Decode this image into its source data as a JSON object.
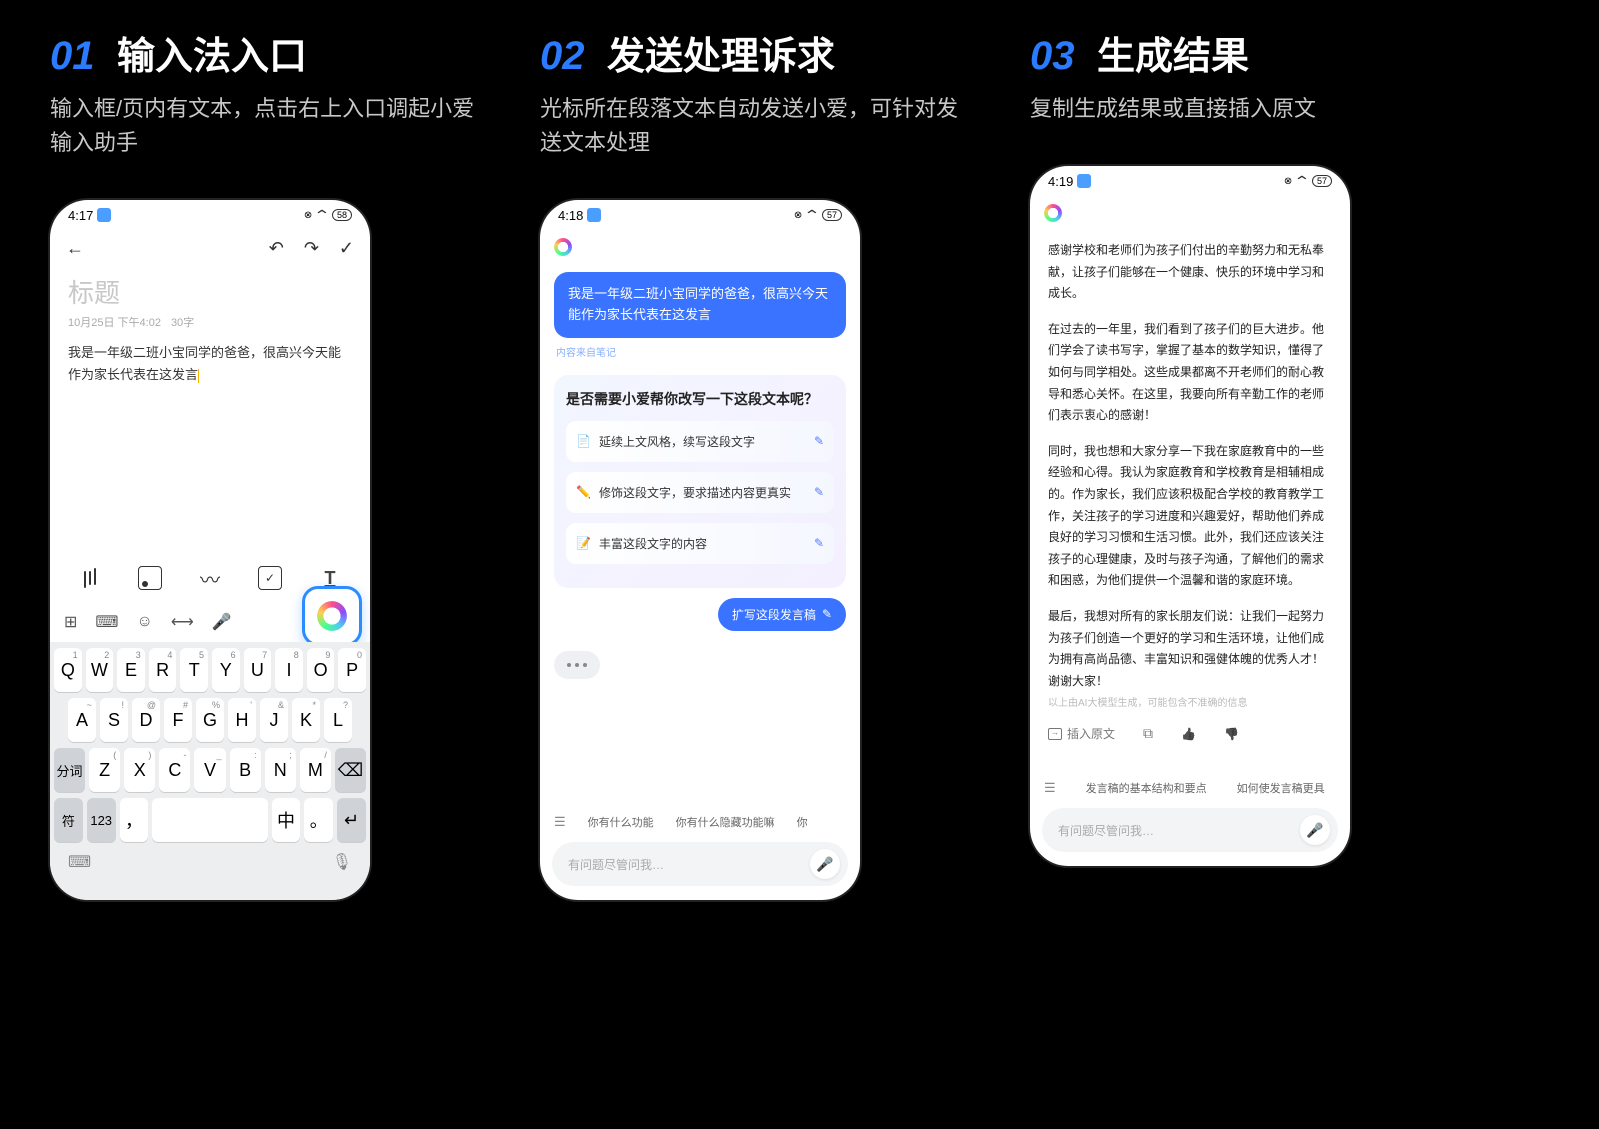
{
  "steps": [
    {
      "num": "01",
      "title": "输入法入口",
      "desc": "输入框/页内有文本，点击右上入口调起小爱输入助手"
    },
    {
      "num": "02",
      "title": "发送处理诉求",
      "desc": "光标所在段落文本自动发送小爱，可针对发送文本处理"
    },
    {
      "num": "03",
      "title": "生成结果",
      "desc": "复制生成结果或直接插入原文"
    }
  ],
  "phone1": {
    "time": "4:17",
    "battery": "58",
    "title_placeholder": "标题",
    "date": "10月25日 下午4:02",
    "wordcount": "30字",
    "body": "我是一年级二班小宝同学的爸爸，很高兴今天能作为家长代表在这发言",
    "keyboard": {
      "row1": [
        {
          "k": "Q",
          "s": "1"
        },
        {
          "k": "W",
          "s": "2"
        },
        {
          "k": "E",
          "s": "3"
        },
        {
          "k": "R",
          "s": "4"
        },
        {
          "k": "T",
          "s": "5"
        },
        {
          "k": "Y",
          "s": "6"
        },
        {
          "k": "U",
          "s": "7"
        },
        {
          "k": "I",
          "s": "8"
        },
        {
          "k": "O",
          "s": "9"
        },
        {
          "k": "P",
          "s": "0"
        }
      ],
      "row2": [
        {
          "k": "A",
          "s": "~"
        },
        {
          "k": "S",
          "s": "!"
        },
        {
          "k": "D",
          "s": "@"
        },
        {
          "k": "F",
          "s": "#"
        },
        {
          "k": "G",
          "s": "%"
        },
        {
          "k": "H",
          "s": "'"
        },
        {
          "k": "J",
          "s": "&"
        },
        {
          "k": "K",
          "s": "*"
        },
        {
          "k": "L",
          "s": "?"
        }
      ],
      "row3_seg": "分词",
      "row3": [
        {
          "k": "Z",
          "s": "("
        },
        {
          "k": "X",
          "s": ")"
        },
        {
          "k": "C",
          "s": "-"
        },
        {
          "k": "V",
          "s": "_"
        },
        {
          "k": "B",
          "s": ":"
        },
        {
          "k": "N",
          "s": ";"
        },
        {
          "k": "M",
          "s": "/"
        }
      ],
      "row4": {
        "sym": "符",
        "num": "123",
        "comma": "，",
        "space": "",
        "zhong": "中",
        "period": "。"
      }
    }
  },
  "phone2": {
    "time": "4:18",
    "battery": "57",
    "user_msg": "我是一年级二班小宝同学的爸爸，很高兴今天能作为家长代表在这发言",
    "source_note": "内容来自笔记",
    "card_title": "是否需要小爱帮你改写一下这段文本呢？",
    "options": [
      {
        "icon": "📄",
        "text": "延续上文风格，续写这段文字"
      },
      {
        "icon": "✏️",
        "text": "修饰这段文字，要求描述内容更真实"
      },
      {
        "icon": "📝",
        "text": "丰富这段文字的内容"
      }
    ],
    "chip": "扩写这段发言稿",
    "suggestions": [
      "你有什么功能",
      "你有什么隐藏功能嘛",
      "你"
    ],
    "input_placeholder": "有问题尽管问我…"
  },
  "phone3": {
    "time": "4:19",
    "battery": "57",
    "paragraphs": [
      "感谢学校和老师们为孩子们付出的辛勤努力和无私奉献，让孩子们能够在一个健康、快乐的环境中学习和成长。",
      "在过去的一年里，我们看到了孩子们的巨大进步。他们学会了读书写字，掌握了基本的数学知识，懂得了如何与同学相处。这些成果都离不开老师们的耐心教导和悉心关怀。在这里，我要向所有辛勤工作的老师们表示衷心的感谢！",
      "同时，我也想和大家分享一下我在家庭教育中的一些经验和心得。我认为家庭教育和学校教育是相辅相成的。作为家长，我们应该积极配合学校的教育教学工作，关注孩子的学习进度和兴趣爱好，帮助他们养成良好的学习习惯和生活习惯。此外，我们还应该关注孩子的心理健康，及时与孩子沟通，了解他们的需求和困惑，为他们提供一个温馨和谐的家庭环境。",
      "最后，我想对所有的家长朋友们说：让我们一起努力为孩子们创造一个更好的学习和生活环境，让他们成为拥有高尚品德、丰富知识和强健体魄的优秀人才！谢谢大家！"
    ],
    "ai_disclaimer": "以上由AI大模型生成，可能包含不准确的信息",
    "insert_label": "插入原文",
    "suggestions": [
      "发言稿的基本结构和要点",
      "如何使发言稿更具"
    ],
    "input_placeholder": "有问题尽管问我…"
  }
}
